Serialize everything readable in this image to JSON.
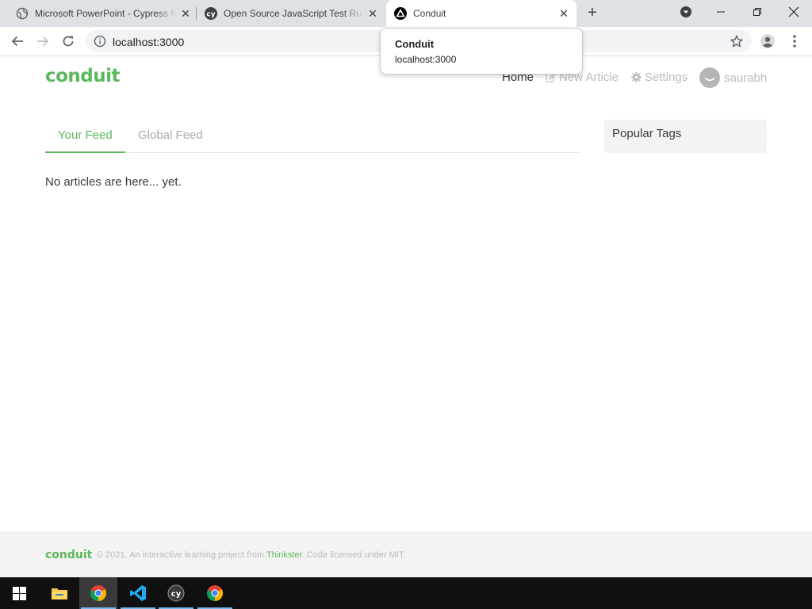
{
  "browser": {
    "tabs": [
      {
        "title": "Microsoft PowerPoint - Cypress fo",
        "favicon": "globe-icon"
      },
      {
        "title": "Open Source JavaScript Test Runn",
        "favicon": "cypress-icon"
      },
      {
        "title": "Conduit",
        "favicon": "conduit-triangle-icon",
        "active": true
      }
    ],
    "url": "localhost:3000"
  },
  "hover_card": {
    "title": "Conduit",
    "url": "localhost:3000"
  },
  "conduit": {
    "brand": "conduit",
    "nav": {
      "home": "Home",
      "new_article": "New Article",
      "settings": "Settings",
      "username": "saurabh"
    },
    "feed_tabs": {
      "your_feed": "Your Feed",
      "global_feed": "Global Feed"
    },
    "empty_message": "No articles are here... yet.",
    "sidebar_title": "Popular Tags",
    "footer": {
      "brand": "conduit",
      "text_before": "© 2021. An interactive learning project from ",
      "link": "Thinkster",
      "text_after": ". Code licensed under MIT."
    },
    "colors": {
      "brand_green": "#5cb85c",
      "muted": "#bbbbbb"
    }
  },
  "taskbar": {
    "items": [
      "windows-start-icon",
      "file-explorer-icon",
      "chrome-icon",
      "vscode-icon",
      "cypress-icon",
      "chrome-icon"
    ]
  }
}
